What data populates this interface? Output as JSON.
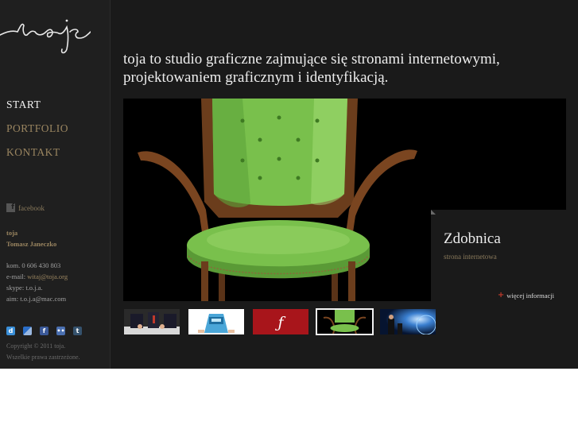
{
  "logo": {
    "alt": "toja"
  },
  "nav": {
    "items": [
      {
        "label": "START",
        "active": true
      },
      {
        "label": "PORTFOLIO",
        "active": false
      },
      {
        "label": "KONTAKT",
        "active": false
      }
    ]
  },
  "sidebar": {
    "facebook_label": "facebook",
    "company": "toja",
    "person": "Tomasz Janeczko",
    "phone": "kom. 0 606 430 803",
    "email_label": "e-mail:",
    "email": "witaj@toja.org",
    "skype": "skype: t.o.j.a.",
    "aim": "aim: t.o.j.a@mac.com",
    "copyright": "Copyright © 2011 toja.",
    "rights": "Wszelkie prawa zastrzeżone."
  },
  "main": {
    "headline_line1": "toja to studio graficzne zajmujące się stronami internetowymi,",
    "headline_line2": "projektowaniem graficznym i identyfikacją.",
    "project_title": "Zdobnica",
    "project_type": "strona internetowa",
    "more_label": "więcej informacji"
  },
  "colors": {
    "background": "#1a1a1a",
    "nav_active": "#f2f2f2",
    "accent_gold": "#9a8560",
    "accent_red": "#c0392b",
    "chair_green": "#79c04c"
  },
  "icons": {
    "social": [
      "delicious-icon",
      "myspace-icon",
      "facebook-icon",
      "flickr-icon",
      "tumblr-icon"
    ]
  },
  "thumbnails": [
    "thumb-businessmen",
    "thumb-dom",
    "thumb-flash",
    "thumb-chair",
    "thumb-space"
  ],
  "selected_thumbnail": 3
}
